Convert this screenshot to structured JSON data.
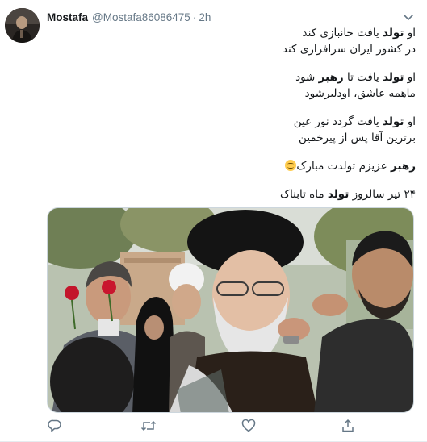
{
  "tweet": {
    "display_name": "Mostafa",
    "handle": "@Mostafa86086475",
    "separator": "·",
    "time": "2h"
  },
  "text": {
    "stanza1": {
      "line1": {
        "a": "او ",
        "b": "تولد",
        "c": " یافت جانبازی کند"
      },
      "line2": "در کشور ایران سرافرازی کند"
    },
    "stanza2": {
      "line1": {
        "a": "او ",
        "b": "تولد",
        "c": " یافت تا ",
        "d": "رهبر",
        "e": " شود"
      },
      "line2": "ماهمه عاشق، اودلبرشود"
    },
    "stanza3": {
      "line1": {
        "a": "او ",
        "b": "تولد",
        "c": " یافت گردد نور عین"
      },
      "line2": "برترین آقا پس از پیرخمین"
    },
    "line4": {
      "a": "رهبر",
      "b": " عزیزم تولدت مبارک"
    },
    "line5": {
      "a": "۲۴ تیر سالروز ",
      "b": "تولد",
      "c": " ماه تابناک"
    }
  },
  "icons": {
    "more": "chevron-down-icon",
    "reply": "reply-icon",
    "retweet": "retweet-icon",
    "like": "heart-icon",
    "share": "share-icon",
    "emoji": "smiling-face-emoji"
  },
  "colors": {
    "name": "#14171a",
    "muted": "#657786",
    "divider": "#e6ecf0"
  }
}
